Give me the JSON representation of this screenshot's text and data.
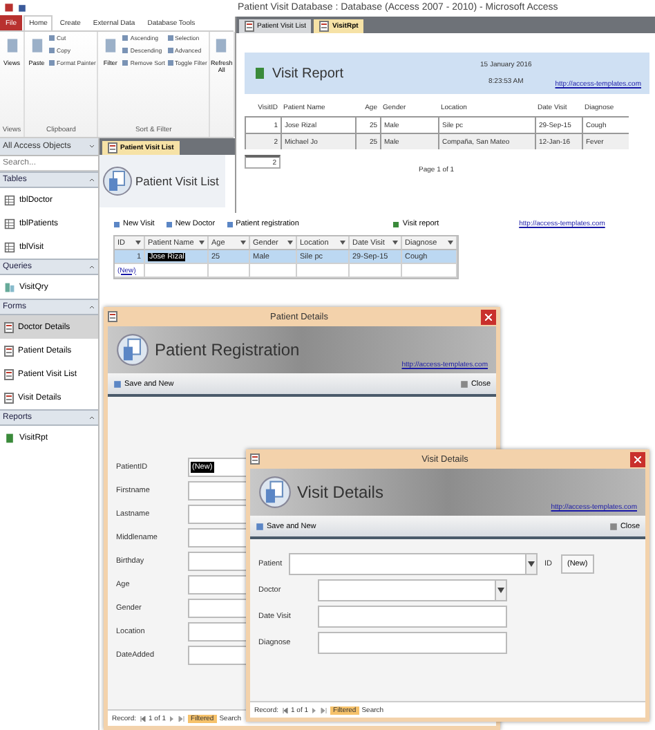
{
  "app_title": "Patient Visit Database : Database (Access 2007 - 2010) - Microsoft Access",
  "ribbon": {
    "tabs": [
      {
        "label": "File",
        "kind": "file",
        "selected": false
      },
      {
        "label": "Home",
        "kind": "tab",
        "selected": true
      },
      {
        "label": "Create",
        "kind": "tab",
        "selected": false
      },
      {
        "label": "External Data",
        "kind": "tab",
        "selected": false
      },
      {
        "label": "Database Tools",
        "kind": "tab",
        "selected": false
      }
    ],
    "groups": [
      {
        "label": "Views",
        "commands": [
          {
            "label": "Views",
            "kind": "large"
          }
        ]
      },
      {
        "label": "Clipboard",
        "commands": [
          {
            "label": "Paste",
            "kind": "large"
          },
          {
            "label": "Cut",
            "kind": "small"
          },
          {
            "label": "Copy",
            "kind": "small"
          },
          {
            "label": "Format Painter",
            "kind": "small"
          }
        ]
      },
      {
        "label": "Sort & Filter",
        "commands": [
          {
            "label": "Filter",
            "kind": "large"
          },
          {
            "label": "Ascending",
            "kind": "small"
          },
          {
            "label": "Descending",
            "kind": "small"
          },
          {
            "label": "Remove Sort",
            "kind": "small"
          },
          {
            "label": "Selection",
            "kind": "small"
          },
          {
            "label": "Advanced",
            "kind": "small"
          },
          {
            "label": "Toggle Filter",
            "kind": "small"
          }
        ]
      },
      {
        "commands": [
          {
            "label": "Refresh All",
            "kind": "large"
          }
        ]
      }
    ]
  },
  "nav": {
    "title": "All Access Objects",
    "search": {
      "placeholder": "Search..."
    },
    "groups": [
      {
        "label": "Tables",
        "items": [
          {
            "label": "tblDoctor",
            "kind": "table",
            "selected": false
          },
          {
            "label": "tblPatients",
            "kind": "table",
            "selected": false
          },
          {
            "label": "tblVisit",
            "kind": "table",
            "selected": false
          }
        ]
      },
      {
        "label": "Queries",
        "items": [
          {
            "label": "VisitQry",
            "kind": "query",
            "selected": false
          }
        ]
      },
      {
        "label": "Forms",
        "items": [
          {
            "label": "Doctor Details",
            "kind": "form",
            "selected": true
          },
          {
            "label": "Patient Details",
            "kind": "form",
            "selected": false
          },
          {
            "label": "Patient Visit List",
            "kind": "form",
            "selected": false
          },
          {
            "label": "Visit Details",
            "kind": "form",
            "selected": false
          }
        ]
      },
      {
        "label": "Reports",
        "items": [
          {
            "label": "VisitRpt",
            "kind": "report",
            "selected": false
          }
        ]
      }
    ]
  },
  "visit_list": {
    "tab": "Patient Visit List",
    "title": "Patient Visit List",
    "actions": [
      "New Visit",
      "New Doctor",
      "Patient registration",
      "Visit report"
    ],
    "link": "http://access-templates.com",
    "columns": [
      "ID",
      "Patient Name",
      "Age",
      "Gender",
      "Location",
      "Date Visit",
      "Diagnose"
    ],
    "rows": [
      {
        "cells": [
          "1",
          "Jose Rizal",
          "25",
          "Male",
          "Sile pc",
          "29-Sep-15",
          "Cough"
        ],
        "selected": true
      }
    ],
    "new_row": "(New)"
  },
  "report": {
    "tabs": [
      {
        "label": "Patient Visit List",
        "selected": false
      },
      {
        "label": "VisitRpt",
        "selected": true
      }
    ],
    "title": "Visit Report",
    "date": "15 January 2016",
    "time": "8:23:53 AM",
    "link": "http://access-templates.com",
    "columns": [
      "VisitID",
      "Patient Name",
      "Age",
      "Gender",
      "Location",
      "Date Visit",
      "Diagnose"
    ],
    "rows": [
      [
        "1",
        "Jose Rizal",
        "25",
        "Male",
        "Sile pc",
        "29-Sep-15",
        "Cough"
      ],
      [
        "2",
        "Michael Jo",
        "25",
        "Male",
        "Compaña, San Mateo",
        "12-Jan-16",
        "Fever"
      ]
    ],
    "count": "2",
    "page": "Page 1 of 1"
  },
  "patient_details": {
    "window_title": "Patient Details",
    "title": "Patient Registration",
    "link": "http://access-templates.com",
    "save": "Save and New",
    "close": "Close",
    "fields": [
      {
        "label": "PatientID",
        "value": "(New)"
      },
      {
        "label": "Firstname"
      },
      {
        "label": "Lastname"
      },
      {
        "label": "Middlename"
      },
      {
        "label": "Birthday"
      },
      {
        "label": "Age"
      },
      {
        "label": "Gender"
      },
      {
        "label": "Location"
      },
      {
        "label": "DateAdded"
      }
    ],
    "record": {
      "label": "Record:",
      "position": "1 of 1",
      "filter": "Filtered",
      "search": "Search"
    }
  },
  "visit_details": {
    "window_title": "Visit Details",
    "title": "Visit Details",
    "link": "http://access-templates.com",
    "save": "Save and New",
    "close": "Close",
    "fields": [
      {
        "label": "Patient",
        "kind": "combo"
      },
      {
        "label": "Doctor",
        "kind": "combo"
      },
      {
        "label": "Date Visit",
        "kind": "text"
      },
      {
        "label": "Diagnose",
        "kind": "text"
      }
    ],
    "id_label": "ID",
    "new_button": "(New)",
    "record": {
      "label": "Record:",
      "position": "1 of 1",
      "filter": "Filtered",
      "search": "Search"
    }
  }
}
